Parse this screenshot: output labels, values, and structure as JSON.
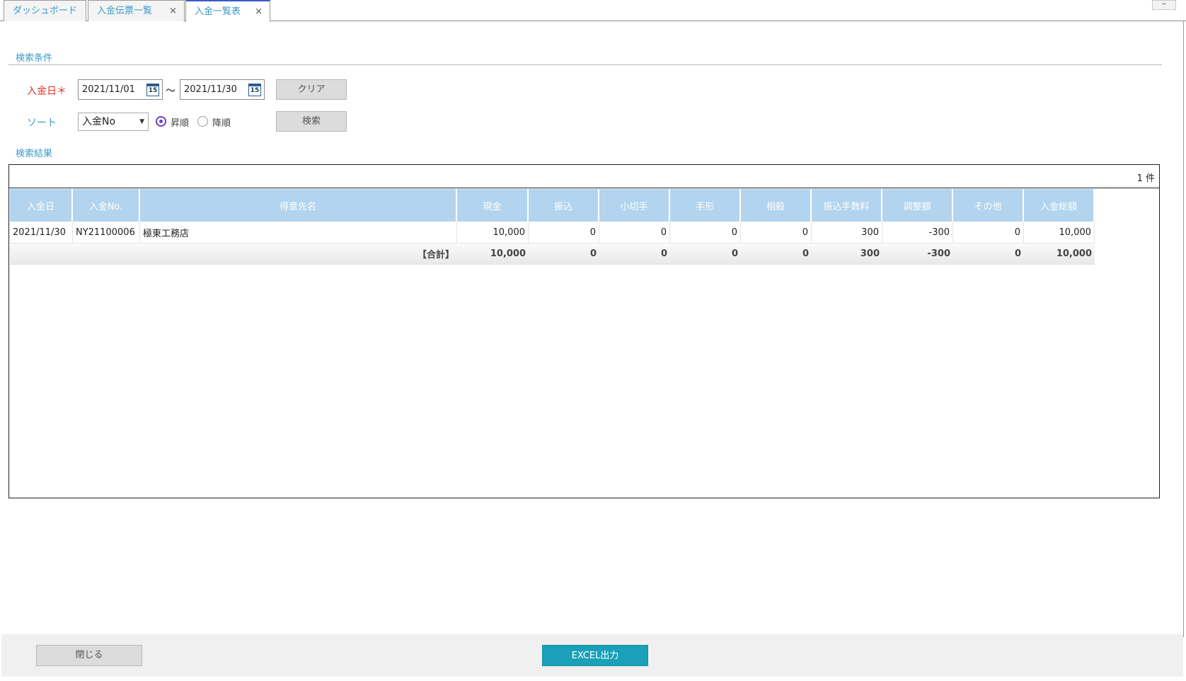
{
  "tabs": [
    {
      "label": "ダッシュボード",
      "closable": false,
      "active": false
    },
    {
      "label": "入金伝票一覧",
      "closable": true,
      "active": false
    },
    {
      "label": "入金一覧表",
      "closable": true,
      "active": true
    }
  ],
  "tab_close_glyph": "×",
  "minimize_glyph": "–",
  "search": {
    "section_title": "検索条件",
    "date_label": "入金日＊",
    "date_from": "2021/11/01",
    "date_to": "2021/11/30",
    "calendar_icon_text": "15",
    "range_separator": "～",
    "clear_button": "クリア",
    "sort_label": "ソート",
    "sort_selected": "入金No",
    "radio_asc": "昇順",
    "radio_desc": "降順",
    "asc_selected": true,
    "search_button": "検索"
  },
  "results": {
    "section_title": "検索結果",
    "count_text": "1 件",
    "columns": [
      "入金日",
      "入金No.",
      "得意先名",
      "現金",
      "振込",
      "小切手",
      "手形",
      "相殺",
      "振込手数料",
      "調整額",
      "その他",
      "入金総額"
    ],
    "rows": [
      [
        "2021/11/30",
        "NY21100006",
        "極東工務店",
        "10,000",
        "0",
        "0",
        "0",
        "0",
        "300",
        "-300",
        "0",
        "10,000"
      ]
    ],
    "total_label": "【合計】",
    "totals": [
      "10,000",
      "0",
      "0",
      "0",
      "0",
      "300",
      "-300",
      "0",
      "10,000"
    ]
  },
  "footer": {
    "close_button": "閉じる",
    "excel_button": "EXCEL出力"
  }
}
